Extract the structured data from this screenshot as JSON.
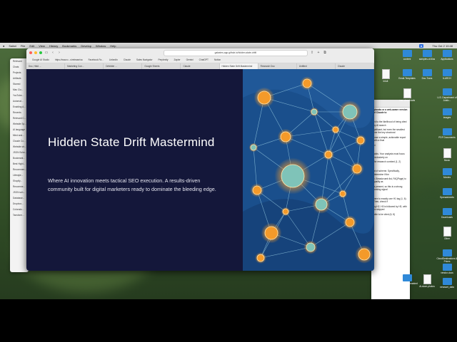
{
  "menubar": {
    "items": [
      "Safari",
      "File",
      "Edit",
      "View",
      "History",
      "Bookmarks",
      "Develop",
      "Window",
      "Help"
    ],
    "clock": "Thu Oct 2  10:48"
  },
  "browser": {
    "address": "galaxies-app.github.io/hidden-state-drift/",
    "bookmarks": [
      "Google AI Studio",
      "https://www.c...s/release/sa",
      "Facebook Fa...",
      "LinkedIn",
      "Claude",
      "Sales Navigator",
      "Perplexity",
      "Zapier",
      "Gemini",
      "ChatGPT",
      "Notion"
    ],
    "tabs": [
      "Doc, Hidd ...",
      "Marketing Con...",
      "Dribbble ...",
      "Google Sheets",
      "Claude",
      "Hidden State Drift Mastermind",
      "Research Doc",
      "Untitled",
      "Claude"
    ]
  },
  "hero": {
    "title": "Hidden State Drift Mastermind",
    "description": "Where AI innovation meets tactical SEO execution. A results-driven community built for digital marketers ready to dominate the bleeding edge."
  },
  "left_window": {
    "items": [
      "Relevant",
      "Chats",
      "Projects",
      "Artifacts",
      "Starred",
      "Mac Clu...",
      "YouTube...",
      "Automat...",
      "Enabling A...",
      "Recents",
      "Relevant C...",
      "Website Sp...",
      "AI language",
      "Mind and...",
      "Claude Co...",
      "Website str...",
      "JSON Sche...",
      "Bookmark...",
      "Best Highl...",
      "Recommen...",
      "Lifestyle...",
      "Shopify...",
      "Recomme...",
      "JSON sch...",
      "Database...",
      "Dropbox...",
      "Colorado...",
      "Tansform..."
    ]
  },
  "right_window": {
    "lines": [
      "gbooks or a web-aware version of Claude to",
      "",
      "ed to the likelihood of being cited by AI search",
      "gnificant, but even the smallest one the key structural",
      "pose a simple, actionable report with a final",
      "pl.",
      "",
      "adds. Your analysis must focus exclusively on",
      "the research combed (1, 2)",
      "",
      "at of scheme. Specifically, determine if the",
      "n. Breadcrumb list, FAQPage) to qualify as",
      "is present, so this is a strong ranking signal",
      "",
      "here to exactly one H1 tag (1, 6). Then, check if",
      "ng H2, H3 is followed by H3, with no skipped",
      "able to be cited (6, 8)"
    ]
  },
  "desktop_icons": [
    "content",
    "samples-of-illus",
    "Applications",
    "Intuit",
    "Email-Templates",
    "Doc-Trans",
    "ILARCH",
    "mac-downloads",
    "U.S. Department of Justic...",
    "Images",
    "PDF Documents",
    "Music",
    "Movies",
    "Spreadsheets",
    "Downloads",
    "Other",
    "CloudDestinations & Prices",
    "vendor-docs",
    "Facebook Unmarked",
    "Ai-store-photos",
    "newsset_data"
  ],
  "colors": {
    "hero_bg": "#14173a",
    "art_bg": "#1a4f8c",
    "node_orange": "#f49a2a",
    "node_teal": "#7fc3b8"
  }
}
